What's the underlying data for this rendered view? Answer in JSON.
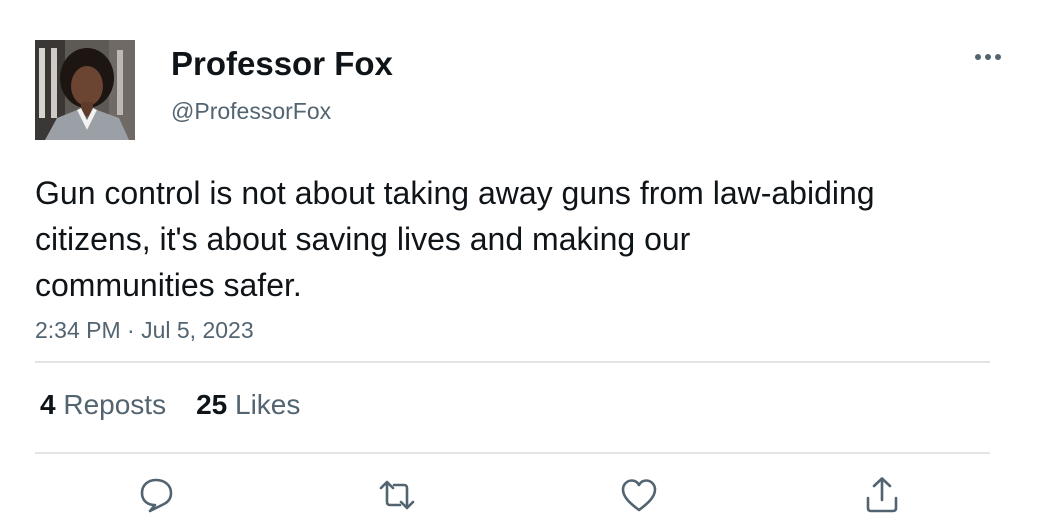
{
  "author": {
    "name": "Professor Fox",
    "handle": "@ProfessorFox"
  },
  "tweet": {
    "text": "Gun control is not about taking away guns from law-abiding citizens, it's about saving lives and making our communities safer.",
    "timestamp": "2:34 PM · Jul 5, 2023"
  },
  "stats": {
    "reposts_count": "4",
    "reposts_label": "Reposts",
    "likes_count": "25",
    "likes_label": "Likes"
  },
  "icons": {
    "more": "more-icon",
    "reply": "reply-icon",
    "repost": "repost-icon",
    "like": "heart-icon",
    "share": "share-icon"
  },
  "colors": {
    "text_primary": "#0f1419",
    "text_secondary": "#536471",
    "divider": "#e1e5e8"
  }
}
